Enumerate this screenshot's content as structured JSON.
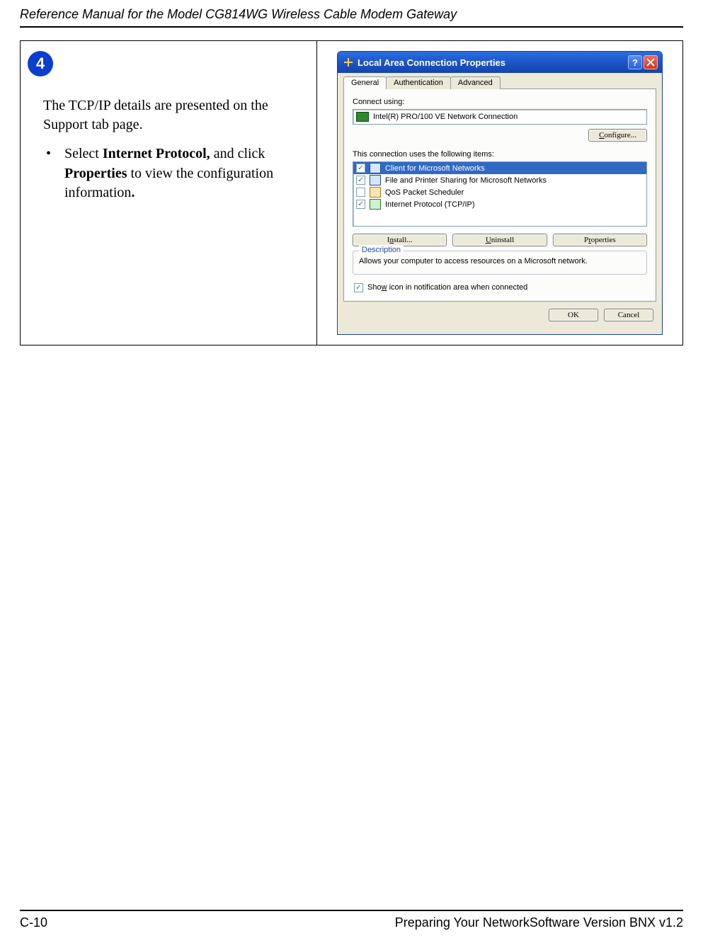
{
  "header": {
    "title": "Reference Manual for the Model CG814WG Wireless Cable Modem Gateway"
  },
  "footer": {
    "page": "C-10",
    "section": "Preparing Your NetworkSoftware Version BNX v1.2"
  },
  "instruction": {
    "step_number": "4",
    "intro": "The TCP/IP details are presented on the Support tab page.",
    "bullet_text_pre": "Select ",
    "bullet_bold1": "Internet Protocol,",
    "bullet_text_mid": " and click ",
    "bullet_bold2": "Properties",
    "bullet_text_post": " to view the configuration information",
    "bullet_period": "."
  },
  "dialog": {
    "title": "Local Area Connection Properties",
    "tabs": {
      "general": "General",
      "auth": "Authentication",
      "advanced": "Advanced"
    },
    "connect_using_label": "Connect using:",
    "adapter_name": "Intel(R) PRO/100 VE Network Connection",
    "configure_btn": "Configure...",
    "items_label": "This connection uses the following items:",
    "items": [
      {
        "checked": true,
        "icon": "client",
        "label": "Client for Microsoft Networks",
        "selected": true
      },
      {
        "checked": true,
        "icon": "file",
        "label": "File and Printer Sharing for Microsoft Networks",
        "selected": false
      },
      {
        "checked": false,
        "icon": "qos",
        "label": "QoS Packet Scheduler",
        "selected": false
      },
      {
        "checked": true,
        "icon": "tcp",
        "label": "Internet Protocol (TCP/IP)",
        "selected": false
      }
    ],
    "install_btn": "Install...",
    "uninstall_btn": "Uninstall",
    "properties_btn": "Properties",
    "desc_legend": "Description",
    "desc_text": "Allows your computer to access resources on a Microsoft network.",
    "show_icon": {
      "checked": true,
      "label_pre": "Sho",
      "label_u": "w",
      "label_post": " icon in notification area when connected"
    },
    "ok_btn": "OK",
    "cancel_btn": "Cancel",
    "underlines": {
      "configure": "C",
      "install": "n",
      "uninstall": "U",
      "properties": "r"
    }
  }
}
